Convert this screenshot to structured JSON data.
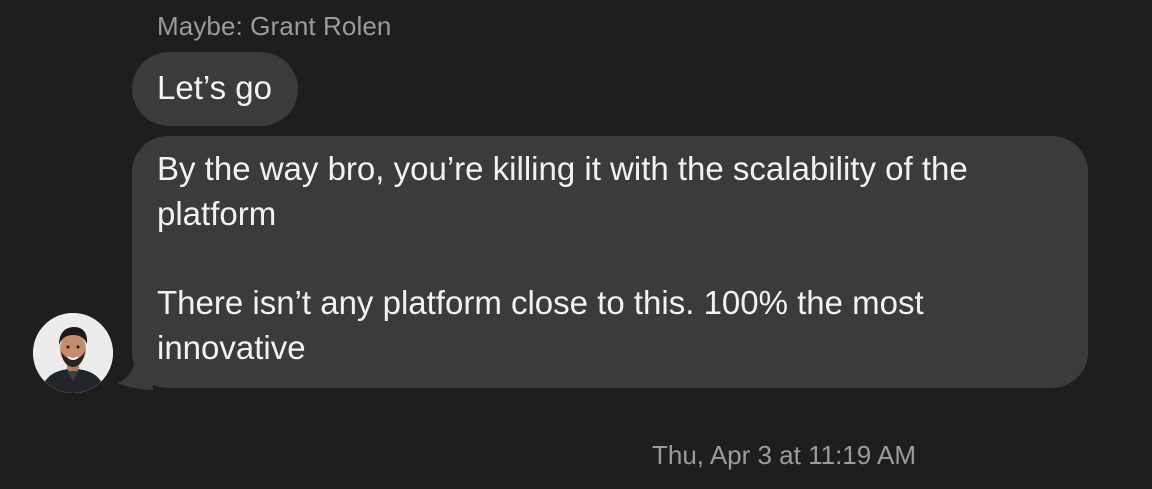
{
  "thread": {
    "sender_label": "Maybe: Grant Rolen",
    "messages": [
      {
        "text": "Let’s go"
      },
      {
        "paragraphs": [
          "By the way bro, you’re killing it with the scalability of the platform",
          "There isn’t any platform close to this. 100% the most innovative"
        ]
      }
    ],
    "avatar_icon": "contact-photo",
    "timestamp": "Thu, Apr 3 at 11:19 AM"
  },
  "colors": {
    "background": "#1e1e1e",
    "bubble": "#3b3b3d",
    "message_text": "#f2f2f2",
    "meta_text": "#9b9b9b"
  }
}
